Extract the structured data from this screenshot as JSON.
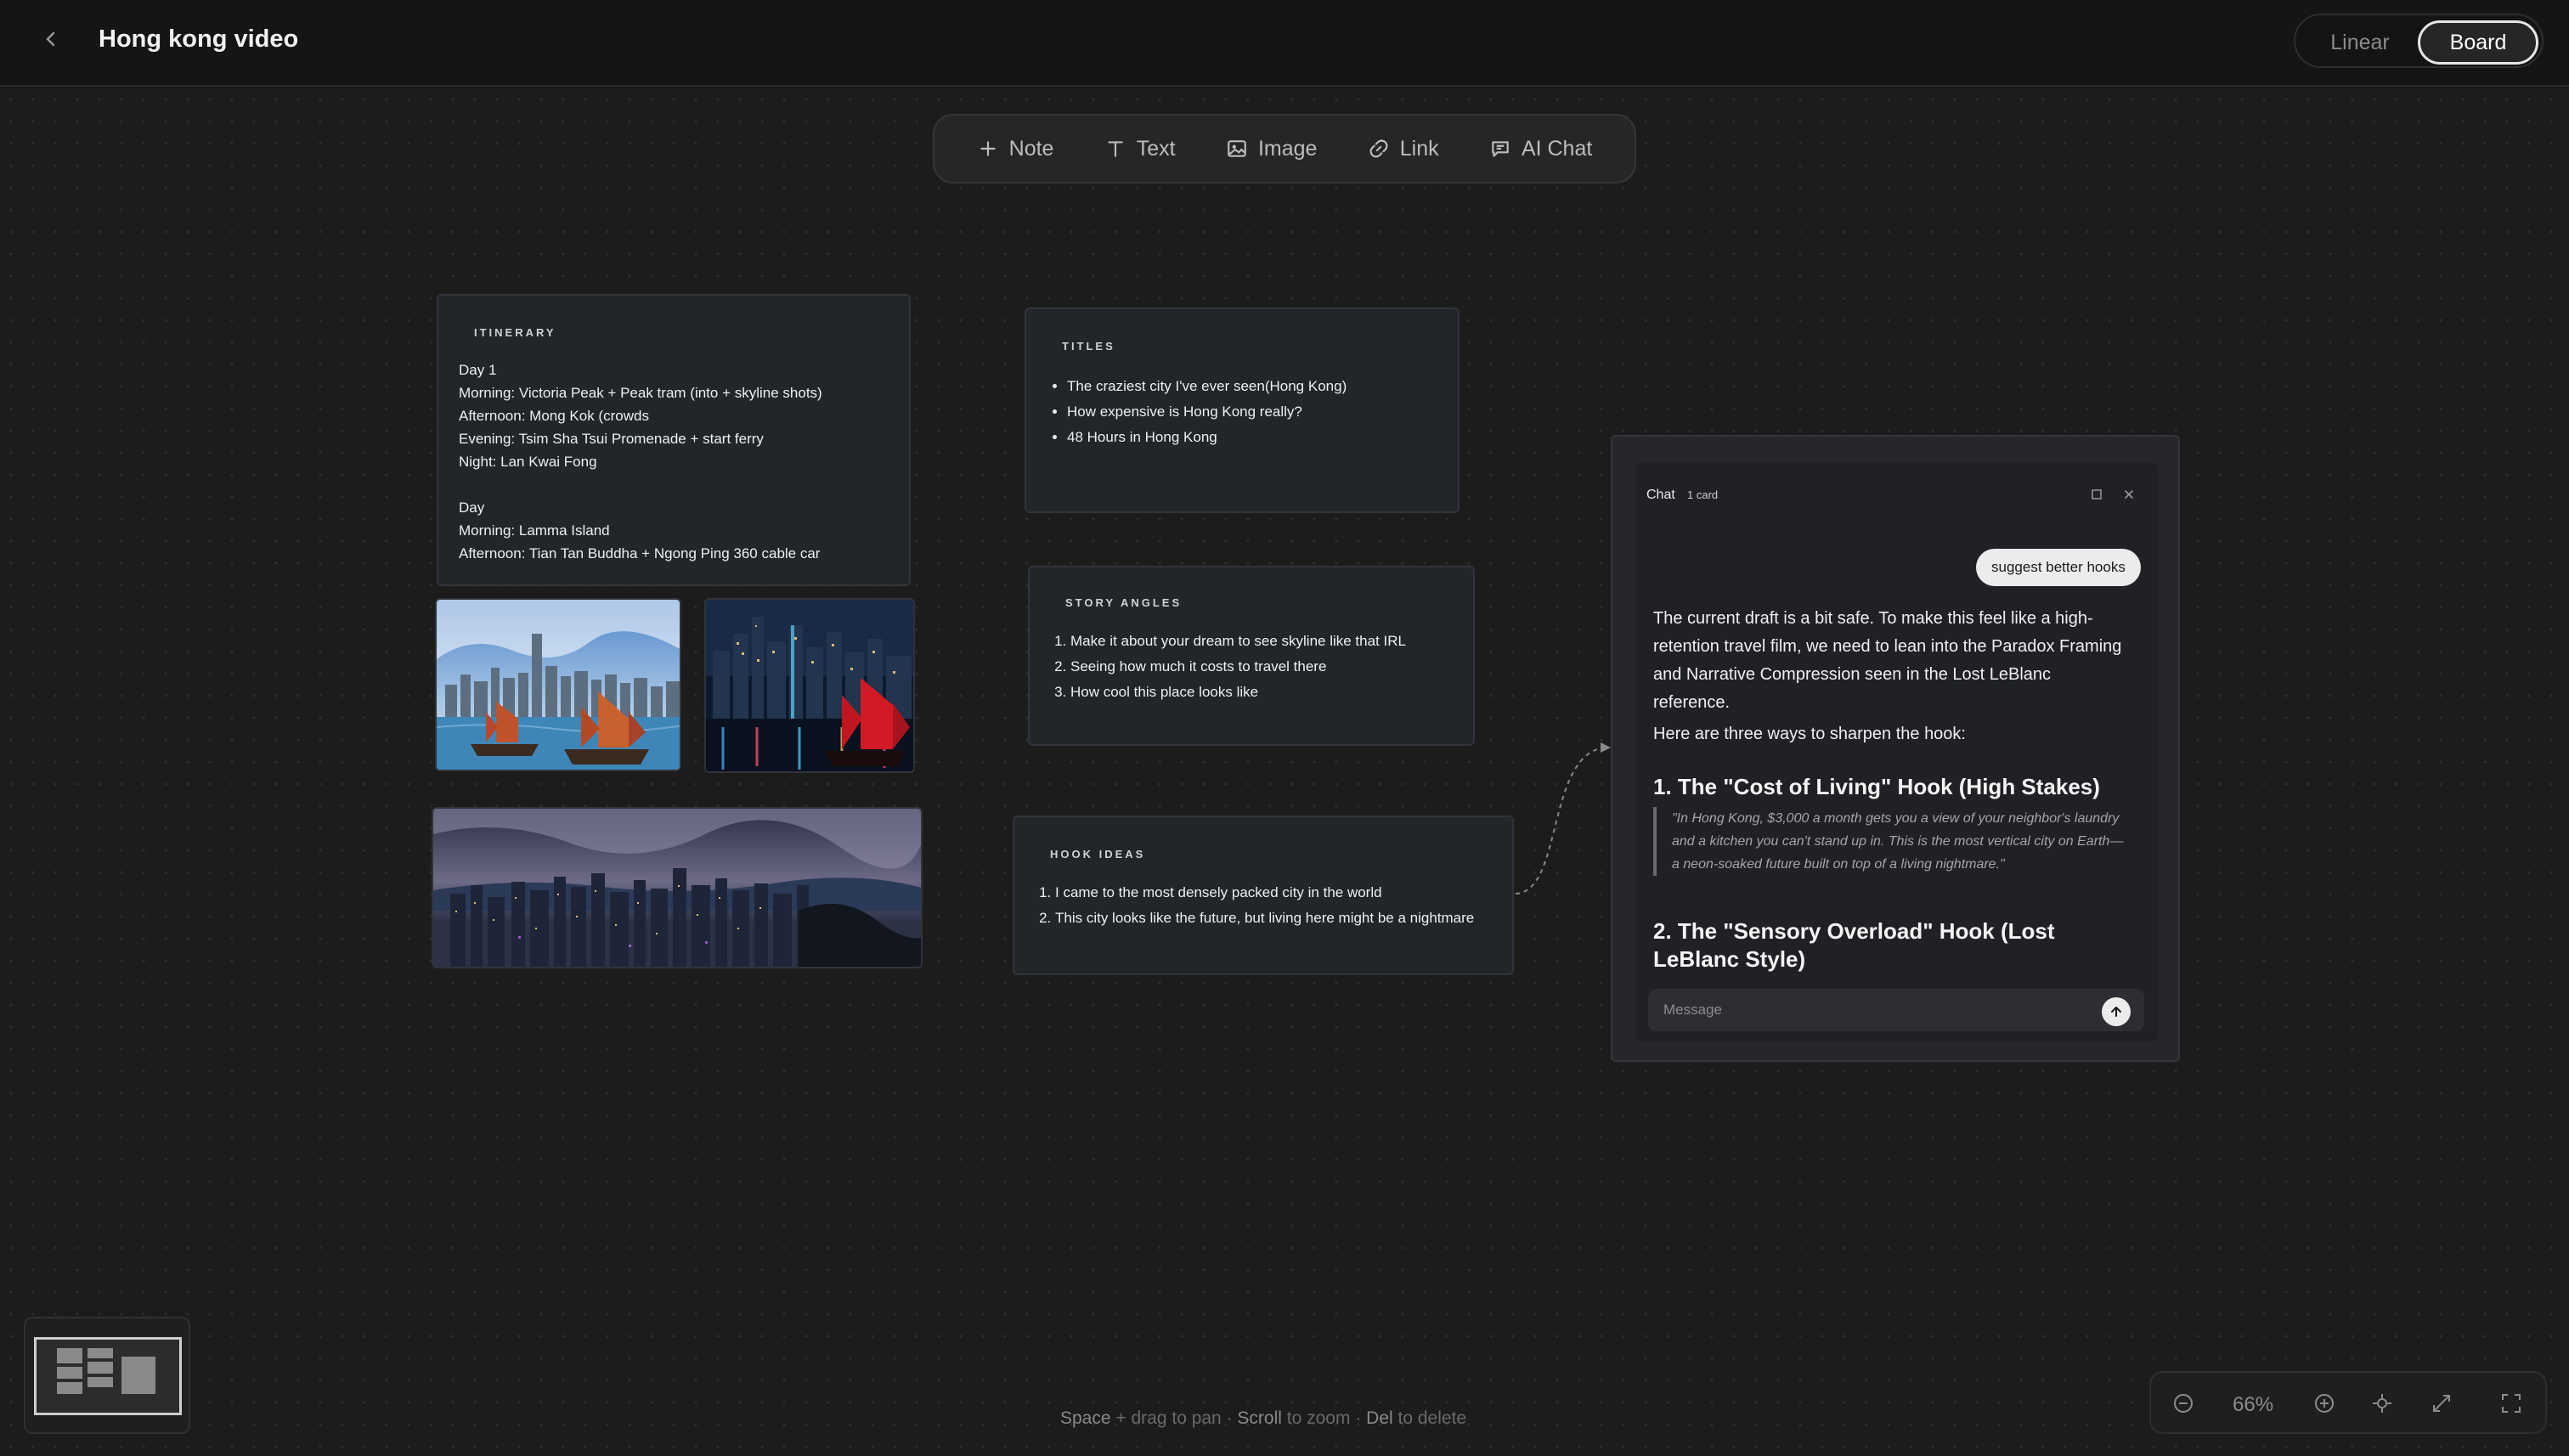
{
  "header": {
    "title": "Hong kong video",
    "views": {
      "linear": "Linear",
      "board": "Board",
      "active": "Board"
    }
  },
  "toolbar": {
    "items": [
      {
        "label": "Note",
        "icon": "plus-icon"
      },
      {
        "label": "Text",
        "icon": "text-icon"
      },
      {
        "label": "Image",
        "icon": "image-icon"
      },
      {
        "label": "Link",
        "icon": "link-icon"
      },
      {
        "label": "AI Chat",
        "icon": "chat-icon"
      }
    ]
  },
  "cards": {
    "itinerary": {
      "label": "ITINERARY",
      "lines": [
        "Day 1",
        "Morning: Victoria Peak + Peak tram (into + skyline shots)",
        "Afternoon: Mong Kok (crowds",
        "Evening: Tsim Sha Tsui Promenade + start ferry",
        "Night: Lan Kwai Fong",
        "",
        "Day",
        "Morning: Lamma Island",
        "Afternoon: Tian Tan Buddha + Ngong Ping 360 cable car"
      ]
    },
    "titles": {
      "label": "TITLES",
      "items": [
        "The craziest city I've ever seen(Hong Kong)",
        "How expensive is Hong Kong really?",
        "48 Hours in Hong Kong"
      ]
    },
    "story_angles": {
      "label": "STORY ANGLES",
      "items": [
        "Make it about your dream to see skyline like that IRL",
        "Seeing how much it costs to travel there",
        "How cool this place looks like"
      ]
    },
    "hook_ideas": {
      "label": "HOOK IDEAS",
      "items": [
        "I came to the most densely packed city in the world",
        "This city looks like the future, but living here might be a nightmare"
      ]
    }
  },
  "chat": {
    "title": "Chat",
    "badge": "1 card",
    "user_message": "suggest better hooks",
    "response_intro": "The current draft is a bit safe. To make this feel like a high-retention travel film, we need to lean into the Paradox Framing and Narrative Compression seen in the Lost LeBlanc reference.",
    "response_lead": "Here are three ways to sharpen the hook:",
    "hook1_title": "1. The \"Cost of Living\" Hook (High Stakes)",
    "hook1_quote": "\"In Hong Kong, $3,000 a month gets you a view of your neighbor's laundry and a kitchen you can't stand up in. This is the most vertical city on Earth—a neon-soaked future built on top of a living nightmare.\"",
    "hook2_title": "2. The \"Sensory Overload\" Hook (Lost LeBlanc Style)",
    "input_placeholder": "Message"
  },
  "footer": {
    "hint_parts": [
      "Space",
      "+ drag to pan ·",
      "Scroll",
      "to zoom ·",
      "Del",
      "to delete"
    ],
    "zoom": "66%"
  }
}
